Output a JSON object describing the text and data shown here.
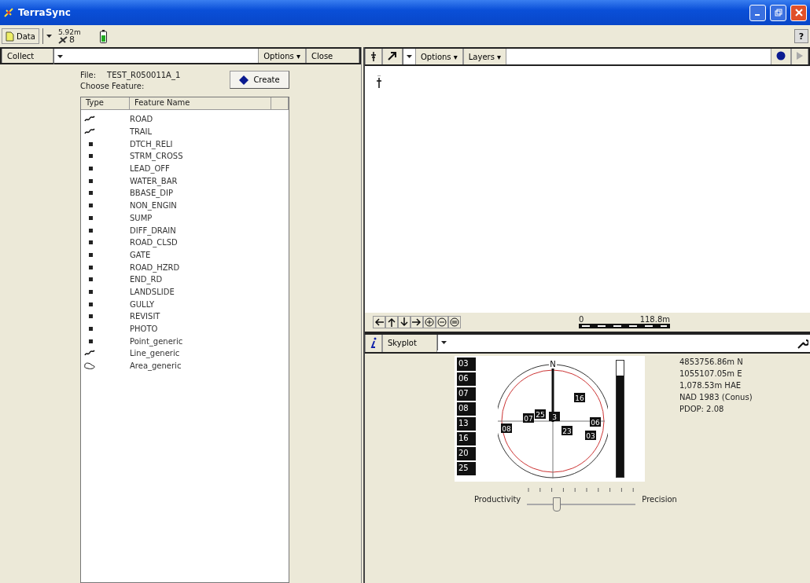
{
  "window": {
    "title": "TerraSync"
  },
  "toolbar": {
    "section": "Data",
    "accuracy": "5.92m",
    "satellites": "8",
    "help": "?"
  },
  "collect": {
    "section": "Collect",
    "options": "Options ▾",
    "close": "Close",
    "file_label": "File:",
    "file_name": "TEST_R050011A_1",
    "choose": "Choose Feature:",
    "create": "Create",
    "columns": [
      "Type",
      "Feature Name"
    ],
    "features": [
      {
        "kind": "line",
        "name": "ROAD"
      },
      {
        "kind": "line",
        "name": "TRAIL"
      },
      {
        "kind": "point",
        "name": "DTCH_RELI"
      },
      {
        "kind": "point",
        "name": "STRM_CROSS"
      },
      {
        "kind": "point",
        "name": "LEAD_OFF"
      },
      {
        "kind": "point",
        "name": "WATER_BAR"
      },
      {
        "kind": "point",
        "name": "BBASE_DIP"
      },
      {
        "kind": "point",
        "name": "NON_ENGIN"
      },
      {
        "kind": "point",
        "name": "SUMP"
      },
      {
        "kind": "point",
        "name": "DIFF_DRAIN"
      },
      {
        "kind": "point",
        "name": "ROAD_CLSD"
      },
      {
        "kind": "point",
        "name": "GATE"
      },
      {
        "kind": "point",
        "name": "ROAD_HZRD"
      },
      {
        "kind": "point",
        "name": "END_RD"
      },
      {
        "kind": "point",
        "name": "LANDSLIDE"
      },
      {
        "kind": "point",
        "name": "GULLY"
      },
      {
        "kind": "point",
        "name": "REVISIT"
      },
      {
        "kind": "point",
        "name": "PHOTO"
      },
      {
        "kind": "point",
        "name": "Point_generic"
      },
      {
        "kind": "line",
        "name": "Line_generic"
      },
      {
        "kind": "area",
        "name": "Area_generic"
      }
    ]
  },
  "map": {
    "options": "Options ▾",
    "layers": "Layers ▾",
    "scale_start": "0",
    "scale_end": "118.8m"
  },
  "skyplot": {
    "section": "Skyplot",
    "north": "N",
    "satellite_list": [
      "03",
      "06",
      "07",
      "08",
      "13",
      "16",
      "20",
      "25"
    ],
    "sky_satellites": [
      "16",
      "07",
      "25",
      "3",
      "06",
      "08",
      "23",
      "03"
    ],
    "signal": {
      "level": 0.87
    },
    "position": [
      "4853756.86m N",
      "1055107.05m E",
      "1,078.53m HAE",
      "NAD 1983 (Conus)",
      "PDOP: 2.08"
    ],
    "slider": {
      "left": "Productivity",
      "right": "Precision",
      "level": 0.27
    }
  }
}
